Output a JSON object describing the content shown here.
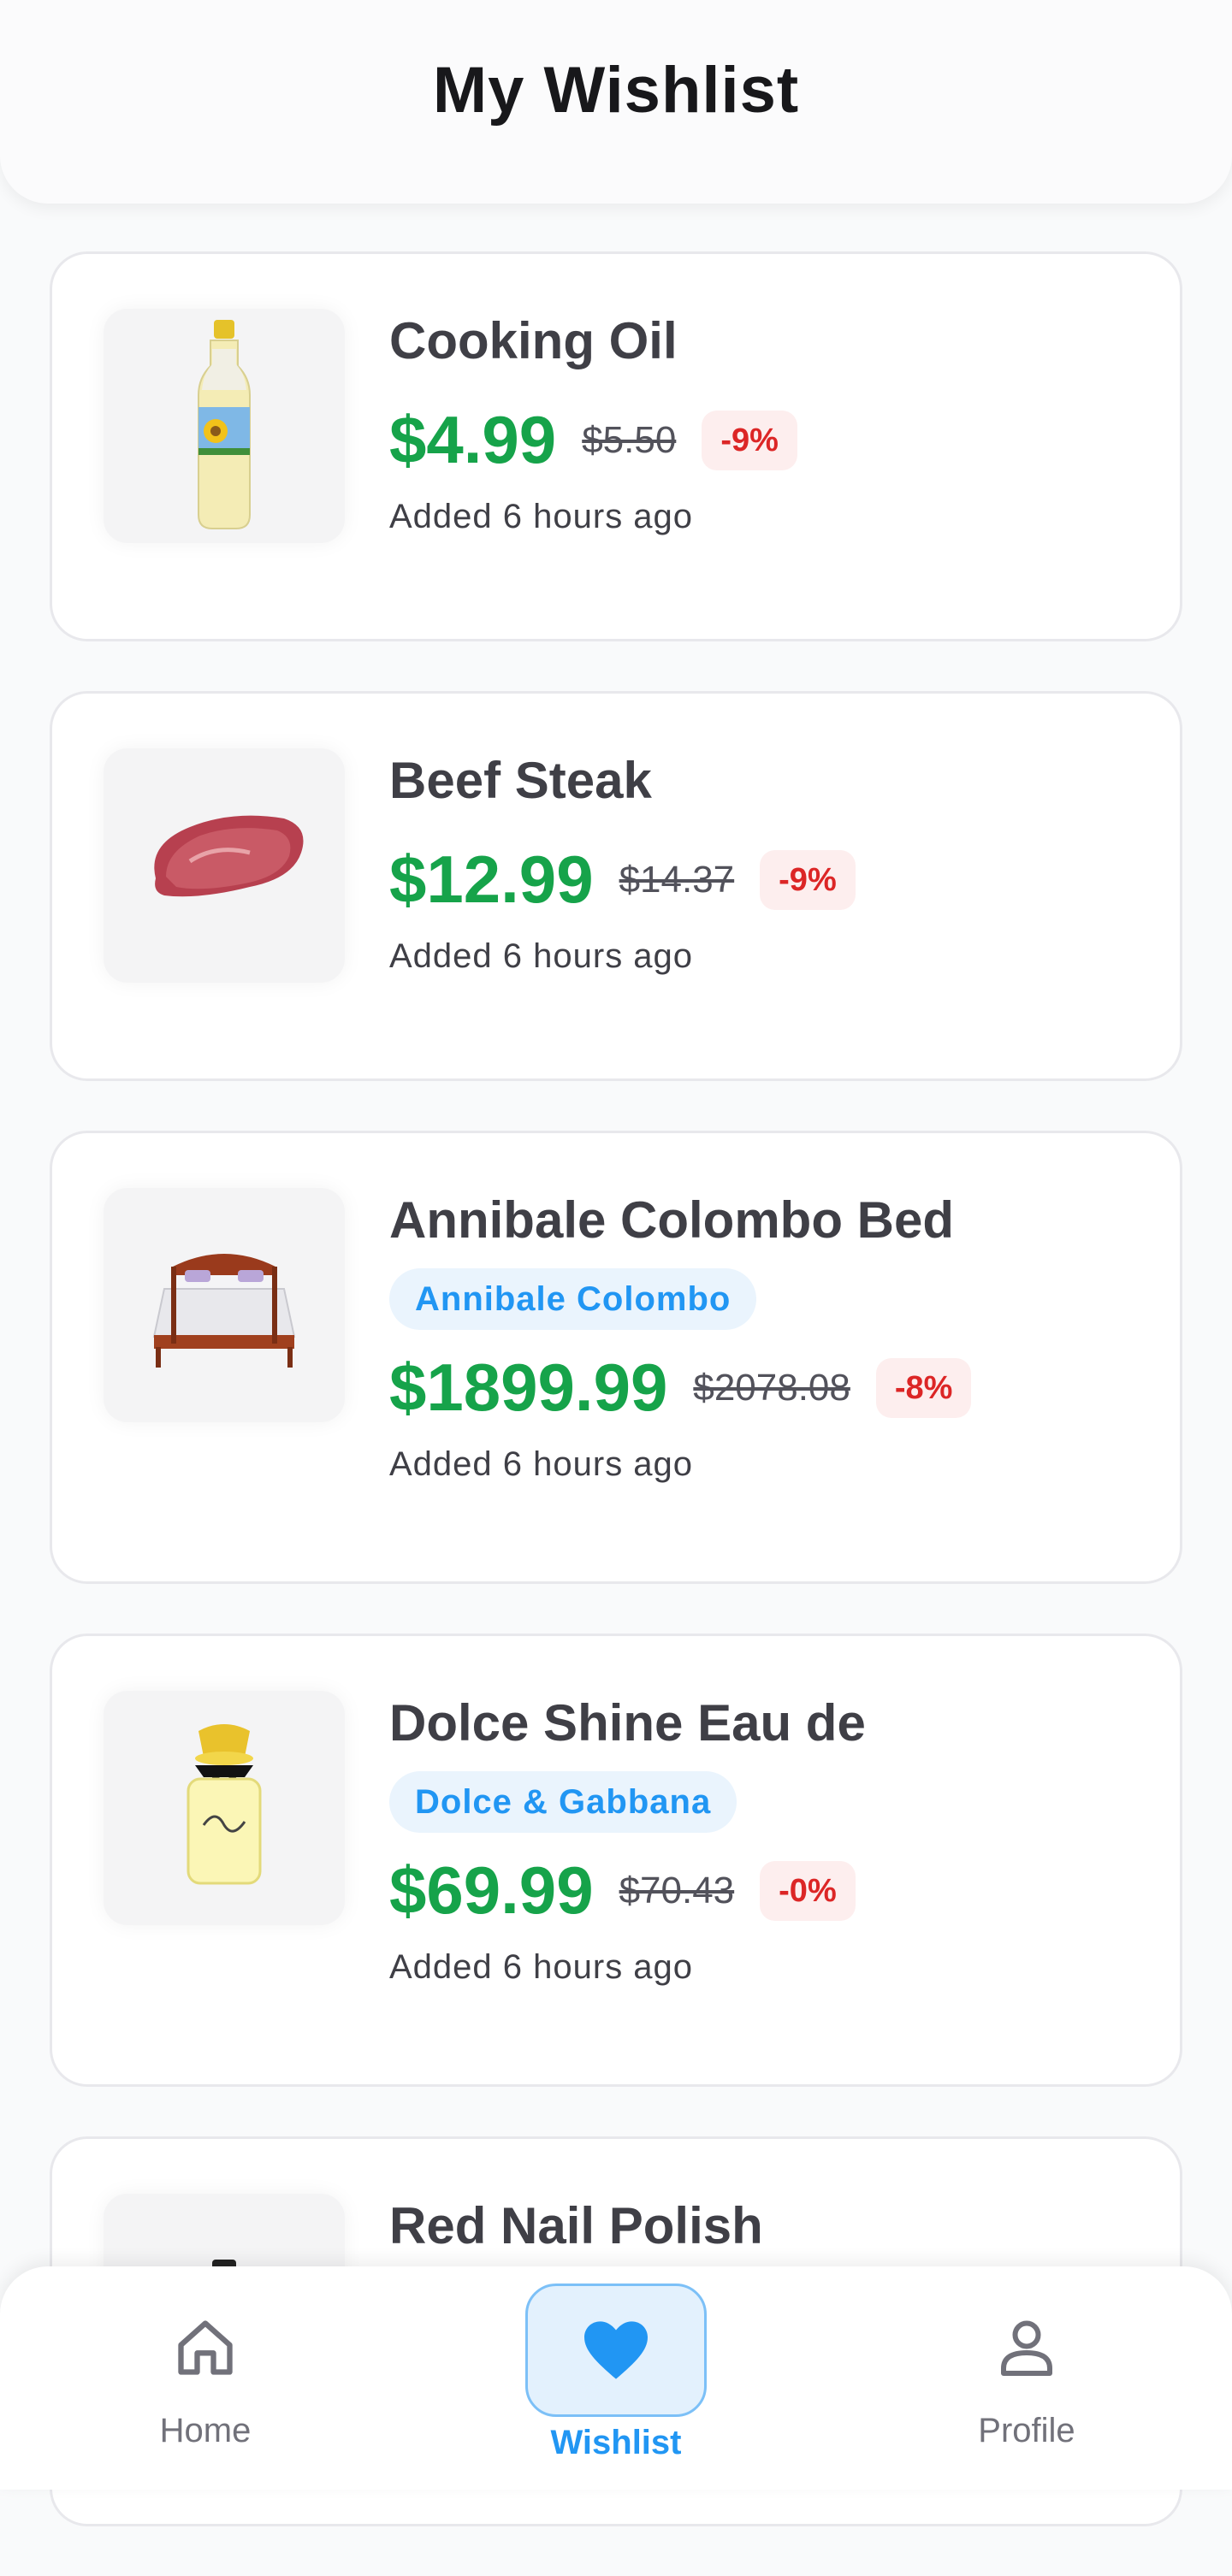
{
  "header": {
    "title": "My Wishlist"
  },
  "items": [
    {
      "name": "Cooking Oil",
      "brand": null,
      "price": "$4.99",
      "old_price": "$5.50",
      "discount": "-9%",
      "added": "Added 6 hours ago",
      "image": "cooking-oil-bottle"
    },
    {
      "name": "Beef Steak",
      "brand": null,
      "price": "$12.99",
      "old_price": "$14.37",
      "discount": "-9%",
      "added": "Added 6 hours ago",
      "image": "beef-steak"
    },
    {
      "name": "Annibale Colombo Bed",
      "brand": "Annibale Colombo",
      "price": "$1899.99",
      "old_price": "$2078.08",
      "discount": "-8%",
      "added": "Added 6 hours ago",
      "image": "bed"
    },
    {
      "name": "Dolce Shine Eau de",
      "brand": "Dolce & Gabbana",
      "price": "$69.99",
      "old_price": "$70.43",
      "discount": "-0%",
      "added": "Added 6 hours ago",
      "image": "perfume-bottle"
    },
    {
      "name": "Red Nail Polish",
      "image": "nail-polish"
    }
  ],
  "nav": {
    "home": "Home",
    "wishlist": "Wishlist",
    "profile": "Profile",
    "active": "wishlist"
  },
  "colors": {
    "accent": "#2196f3",
    "price": "#16a34a",
    "discount": "#dc2626"
  }
}
